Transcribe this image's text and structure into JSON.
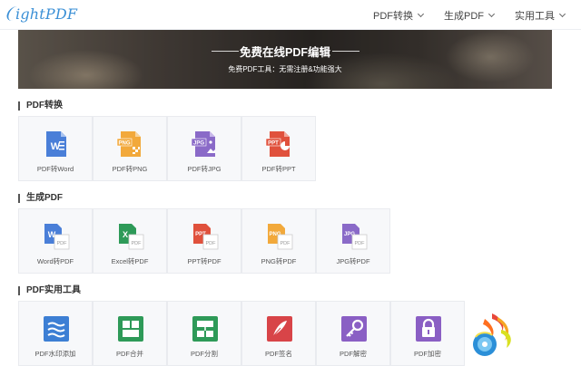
{
  "header": {
    "logo_text": "ightPDF",
    "nav": [
      {
        "label": "PDF转换"
      },
      {
        "label": "生成PDF"
      },
      {
        "label": "实用工具"
      }
    ]
  },
  "banner": {
    "title": "免费在线PDF编辑",
    "subtitle": "免费PDF工具：无需注册&功能强大"
  },
  "sections": [
    {
      "title": "PDF转换",
      "tools": [
        {
          "label": "PDF转Word",
          "icon": "word-doc-icon",
          "color": "#4a7fd8"
        },
        {
          "label": "PDF转PNG",
          "icon": "png-doc-icon",
          "color": "#f2a93b"
        },
        {
          "label": "PDF转JPG",
          "icon": "jpg-doc-icon",
          "color": "#8a6ac8"
        },
        {
          "label": "PDF转PPT",
          "icon": "ppt-doc-icon",
          "color": "#e0513c"
        }
      ]
    },
    {
      "title": "生成PDF",
      "tools": [
        {
          "label": "Word转PDF",
          "icon": "word-to-pdf-icon",
          "color": "#4a7fd8"
        },
        {
          "label": "Excel转PDF",
          "icon": "excel-to-pdf-icon",
          "color": "#2e9a58"
        },
        {
          "label": "PPT转PDF",
          "icon": "ppt-to-pdf-icon",
          "color": "#e0513c"
        },
        {
          "label": "PNG转PDF",
          "icon": "png-to-pdf-icon",
          "color": "#f2a93b"
        },
        {
          "label": "JPG转PDF",
          "icon": "jpg-to-pdf-icon",
          "color": "#8a6ac8"
        }
      ]
    },
    {
      "title": "PDF实用工具",
      "tools": [
        {
          "label": "PDF水印添加",
          "icon": "watermark-icon",
          "color": "#3d7fd4"
        },
        {
          "label": "PDF合并",
          "icon": "merge-icon",
          "color": "#2e9a58"
        },
        {
          "label": "PDF分割",
          "icon": "split-icon",
          "color": "#2e9a58"
        },
        {
          "label": "PDF签名",
          "icon": "signature-icon",
          "color": "#d84448"
        },
        {
          "label": "PDF解密",
          "icon": "unlock-key-icon",
          "color": "#8a5fc4"
        },
        {
          "label": "PDF加密",
          "icon": "lock-icon",
          "color": "#8a5fc4"
        }
      ]
    }
  ]
}
